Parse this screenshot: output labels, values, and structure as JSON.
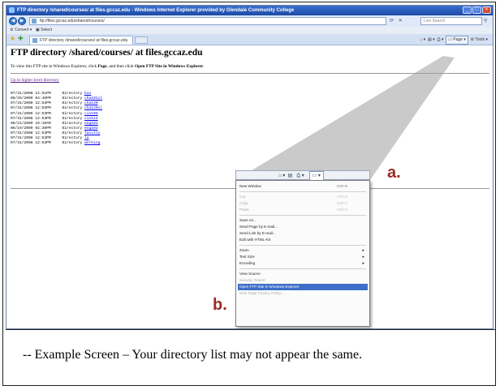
{
  "window": {
    "title": "FTP directory /shared/courses/ at files.gccaz.edu - Windows Internet Explorer provided by Glendale Community College"
  },
  "address_bar": {
    "url": "ftp://files.gccaz.edu/shared/courses/",
    "search_placeholder": "Live Search"
  },
  "links_bar": {
    "convert_label": "Convert",
    "select_label": "Select"
  },
  "tab": {
    "label": "FTP directory /shared/courses/ at files.gccaz.edu"
  },
  "command_bar": {
    "page_label": "Page",
    "tools_label": "Tools"
  },
  "page": {
    "heading": "FTP directory /shared/courses/ at files.gccaz.edu",
    "instruction_prefix": "To view this FTP site in Windows Explorer, click ",
    "instruction_page": "Page",
    "instruction_mid": ", and then click ",
    "instruction_open": "Open FTP Site in Windows Explorer",
    "instruction_end": ".",
    "up_link": "Up to higher level directory",
    "entries": [
      {
        "date": "07/31/2008",
        "time": "12:51PM",
        "type": "Directory",
        "name": "bio"
      },
      {
        "date": "08/26/2009",
        "time": "04:46PM",
        "type": "Directory",
        "name": "cha101il"
      },
      {
        "date": "07/31/2008",
        "time": "12:53PM",
        "type": "Directory",
        "name": "cha130"
      },
      {
        "date": "07/31/2008",
        "time": "12:53PM",
        "type": "Directory",
        "name": "cha130il"
      },
      {
        "date": "07/31/2008",
        "time": "12:53PM",
        "type": "Directory",
        "name": "cis105"
      },
      {
        "date": "07/31/2008",
        "time": "12:53PM",
        "type": "Directory",
        "name": "cis114"
      },
      {
        "date": "08/21/2009",
        "time": "10:10AM",
        "type": "Directory",
        "name": "eng101"
      },
      {
        "date": "08/19/2009",
        "time": "02:36PM",
        "type": "Directory",
        "name": "eng102"
      },
      {
        "date": "07/31/2008",
        "time": "12:53PM",
        "type": "Directory",
        "name": "faculty"
      },
      {
        "date": "07/31/2008",
        "time": "12:53PM",
        "type": "Directory",
        "name": "la"
      },
      {
        "date": "07/31/2008",
        "time": "12:53PM",
        "type": "Directory",
        "name": "working"
      }
    ]
  },
  "context_menu": {
    "items": [
      {
        "label": "New Window",
        "shortcut": "Ctrl+N",
        "disabled": false
      },
      {
        "separator": true
      },
      {
        "label": "Cut",
        "shortcut": "Ctrl+X",
        "disabled": true
      },
      {
        "label": "Copy",
        "shortcut": "Ctrl+C",
        "disabled": true
      },
      {
        "label": "Paste",
        "shortcut": "Ctrl+V",
        "disabled": true
      },
      {
        "separator": true
      },
      {
        "label": "Save As...",
        "shortcut": "",
        "disabled": false
      },
      {
        "label": "Send Page by E-mail...",
        "shortcut": "",
        "disabled": false
      },
      {
        "label": "Send Link by E-mail...",
        "shortcut": "",
        "disabled": false
      },
      {
        "label": "Edit with HTML-Kit",
        "shortcut": "",
        "disabled": false
      },
      {
        "separator": true
      },
      {
        "label": "Zoom",
        "shortcut": "",
        "disabled": false,
        "submenu": true
      },
      {
        "label": "Text Size",
        "shortcut": "",
        "disabled": false,
        "submenu": true
      },
      {
        "label": "Encoding",
        "shortcut": "",
        "disabled": false,
        "submenu": true
      },
      {
        "separator": true
      },
      {
        "label": "View Source",
        "shortcut": "",
        "disabled": false
      },
      {
        "label": "Security Report",
        "shortcut": "",
        "disabled": true
      },
      {
        "label": "Open FTP Site in Windows Explorer",
        "shortcut": "",
        "disabled": false,
        "selected": true
      },
      {
        "label": "Web Page Privacy Policy...",
        "shortcut": "",
        "disabled": true
      }
    ]
  },
  "annotations": {
    "a": "a.",
    "b": "b."
  },
  "caption": "-- Example Screen – Your directory list may not appear the same.",
  "colors": {
    "annotation": "#9a2a26",
    "menu_highlight": "#3d6fc8",
    "link": "#0000ee",
    "visited_link": "#551a8b"
  }
}
